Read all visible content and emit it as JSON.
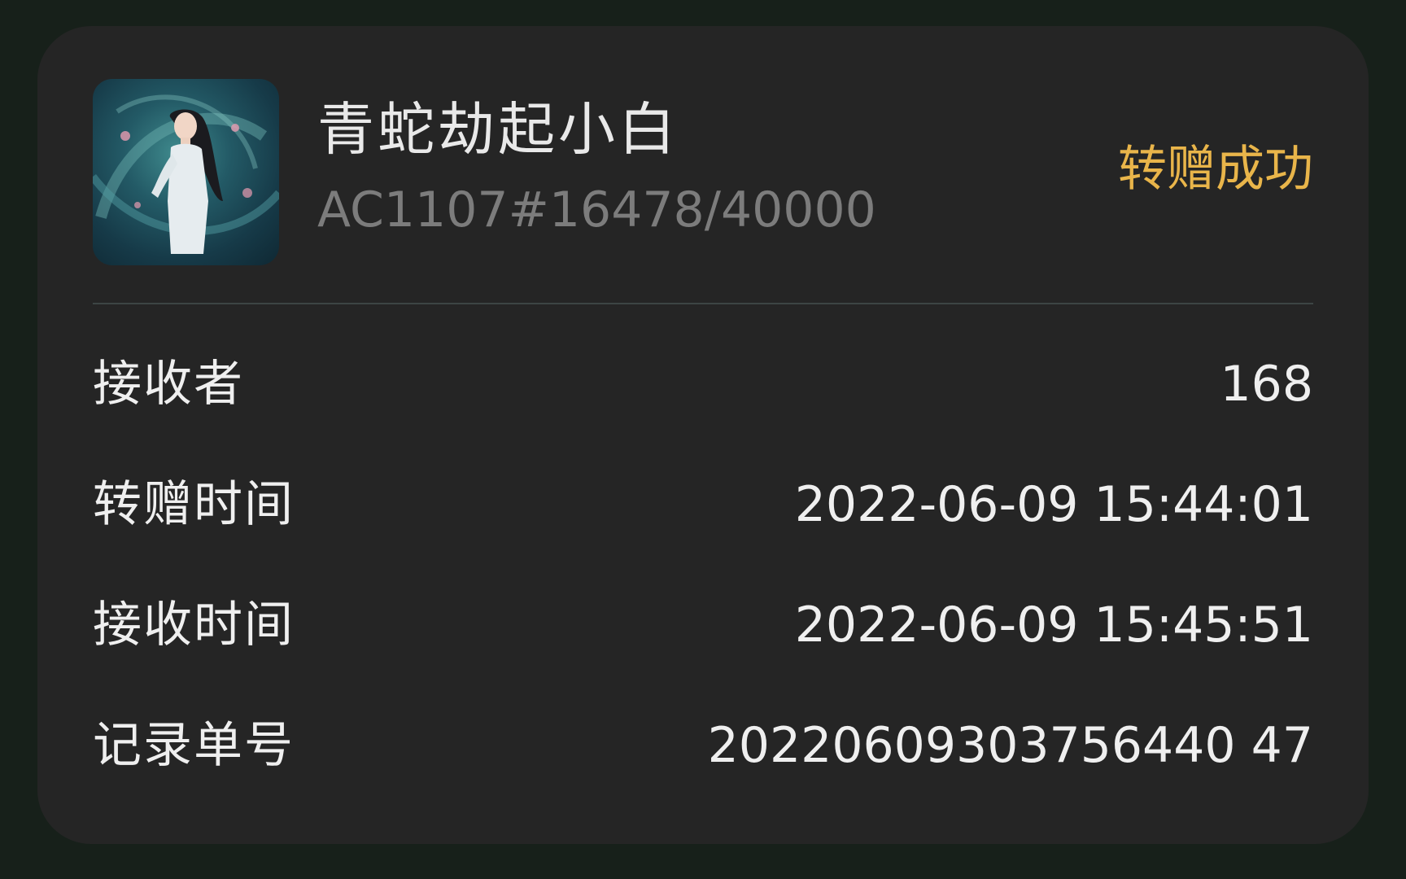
{
  "item": {
    "title": "青蛇劫起小白",
    "serial": "AC1107#16478/40000",
    "status": "转赠成功",
    "image": "character-artwork"
  },
  "details": [
    {
      "label": "接收者",
      "value": "168"
    },
    {
      "label": "转赠时间",
      "value": "2022-06-09 15:44:01"
    },
    {
      "label": "接收时间",
      "value": "2022-06-09 15:45:51"
    },
    {
      "label": "记录单号",
      "value": "20220609303756440 47"
    }
  ],
  "colors": {
    "background": "#17201a",
    "card": "#252525",
    "status": "#e9b54a",
    "serial": "#7c7c7c"
  }
}
